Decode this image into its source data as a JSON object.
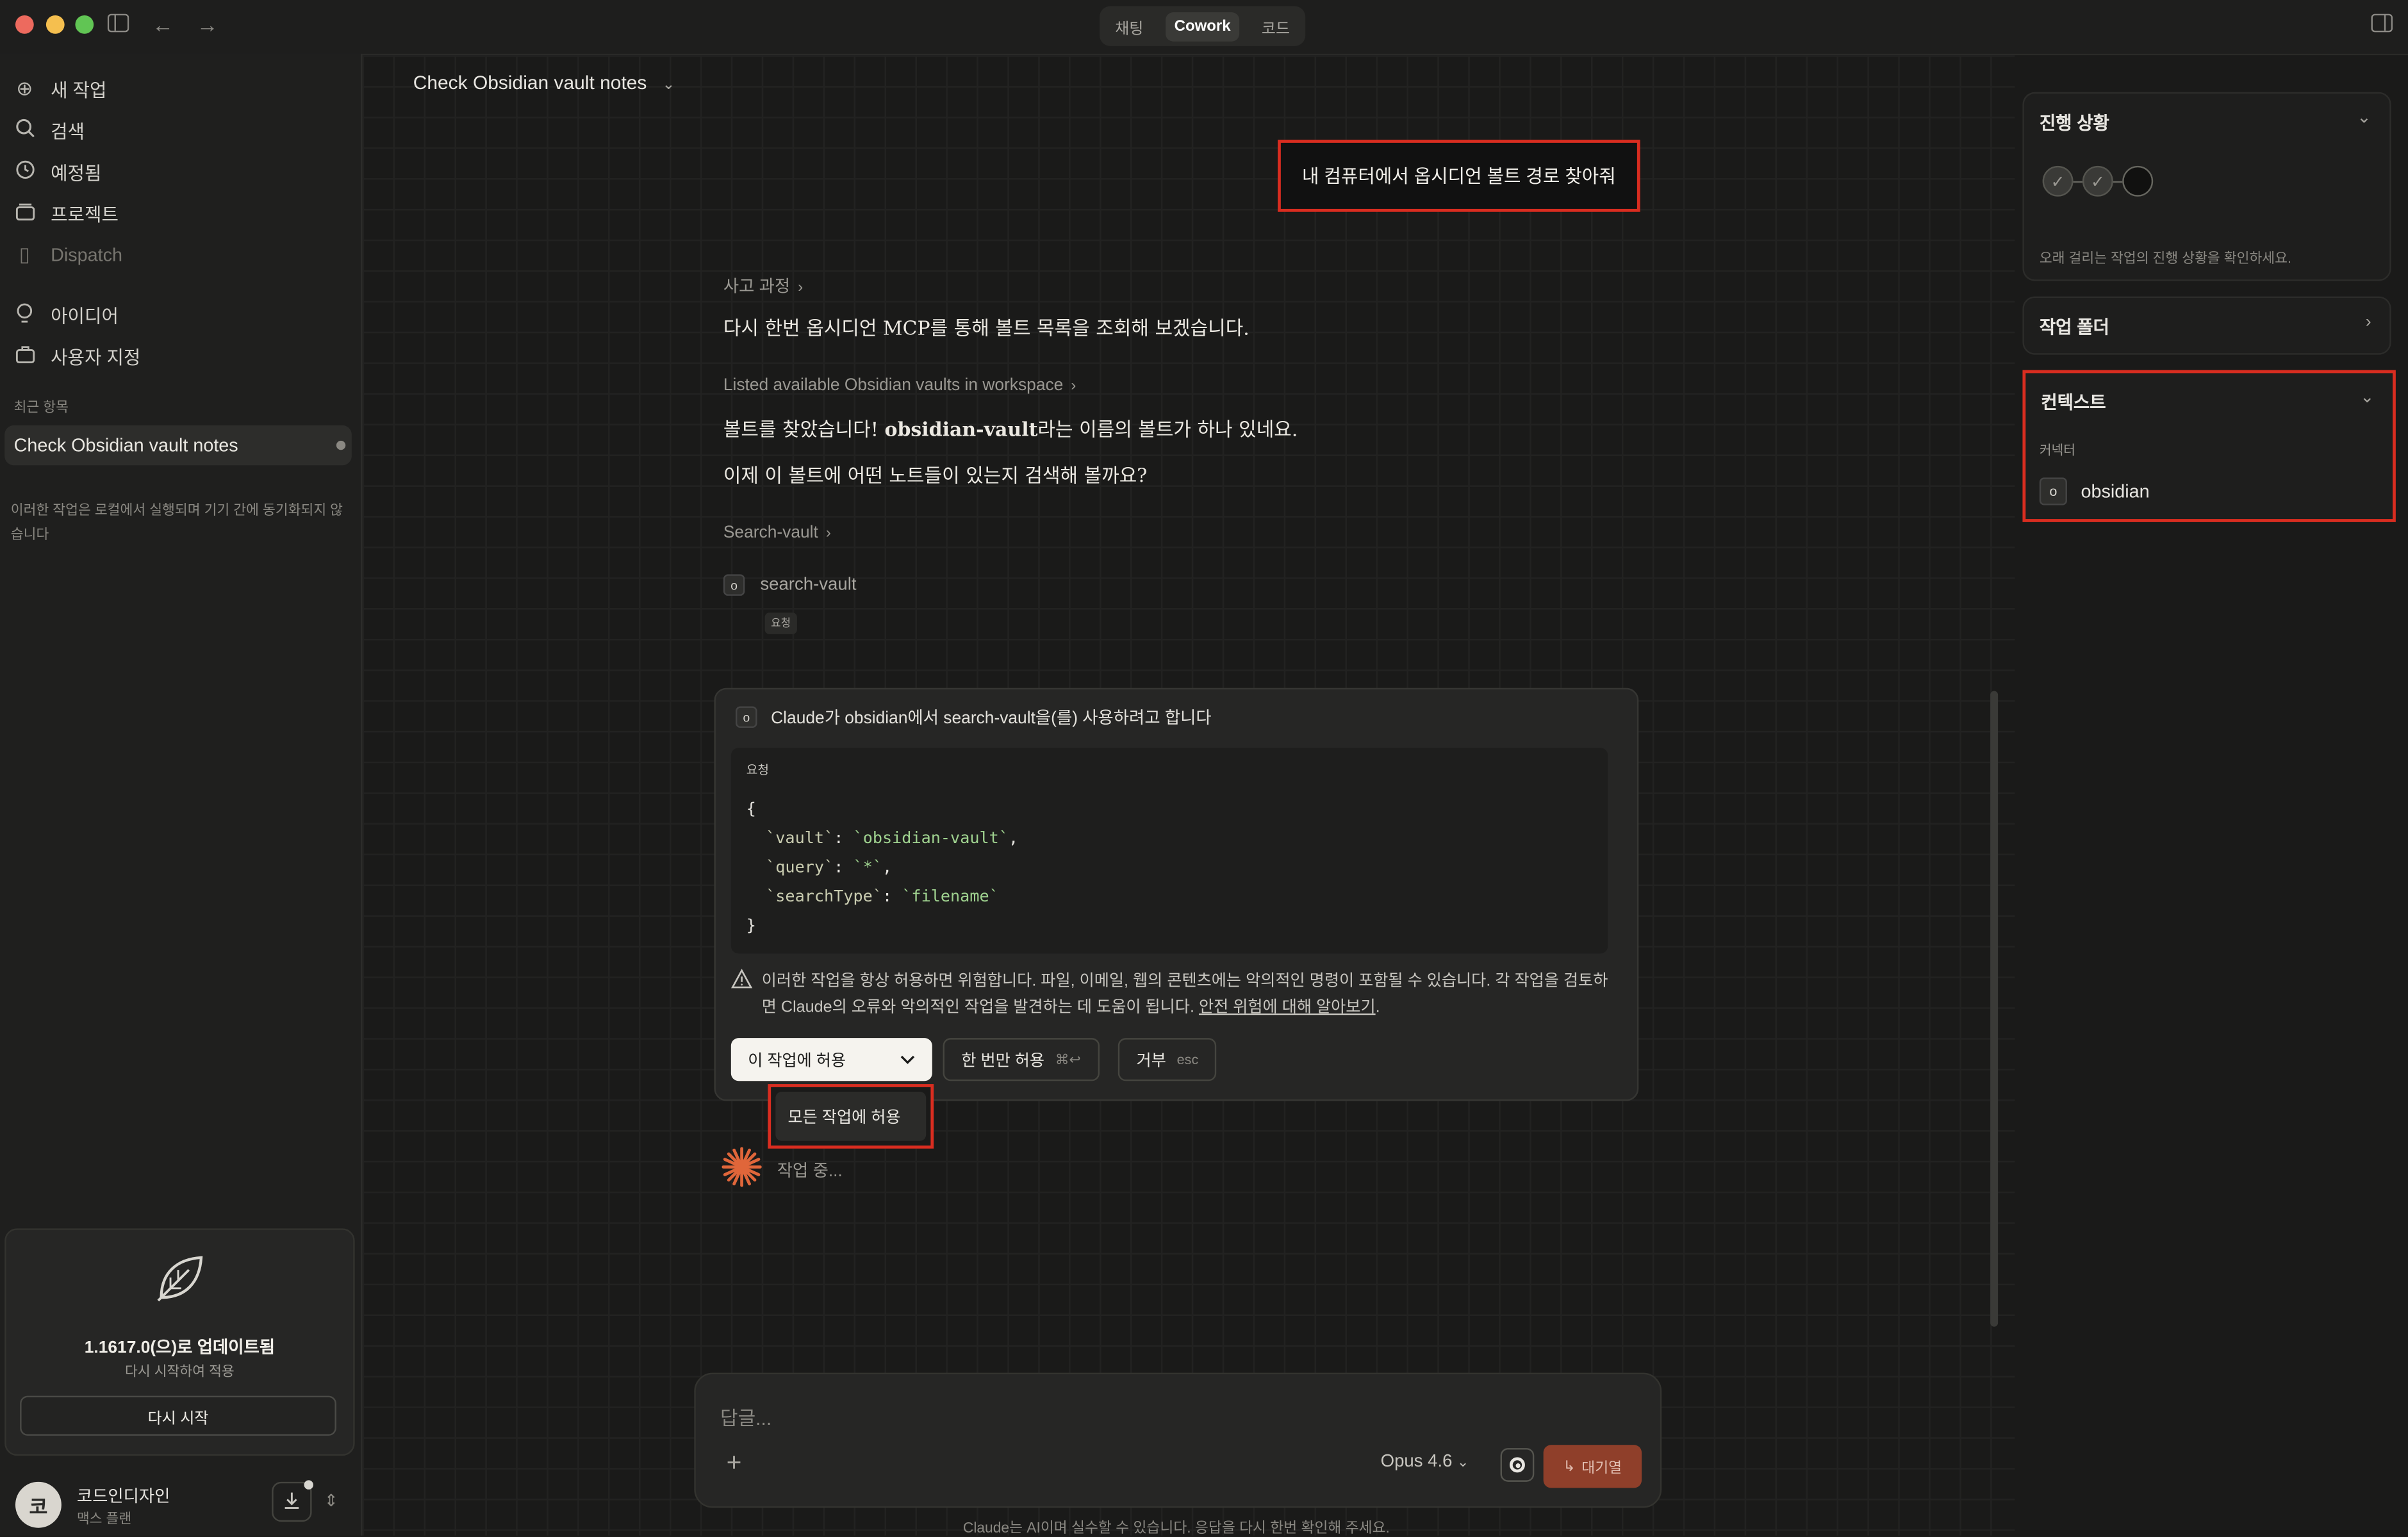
{
  "titlebar": {
    "tabs": [
      {
        "label": "채팅",
        "active": false
      },
      {
        "label": "Cowork",
        "active": true
      },
      {
        "label": "코드",
        "active": false
      }
    ]
  },
  "sidebar": {
    "nav": [
      {
        "label": "새 작업",
        "icon": "plus-icon"
      },
      {
        "label": "검색",
        "icon": "search-icon"
      },
      {
        "label": "예정됨",
        "icon": "clock-icon"
      },
      {
        "label": "프로젝트",
        "icon": "folder-icon"
      },
      {
        "label": "Dispatch",
        "icon": "phone-icon"
      },
      {
        "label": "아이디어",
        "icon": "lightbulb-icon"
      },
      {
        "label": "사용자 지정",
        "icon": "briefcase-icon"
      }
    ],
    "recent_label": "최근 항목",
    "recent_items": [
      "Check Obsidian vault notes"
    ],
    "local_note": "이러한 작업은 로컬에서 실행되며 기기 간에 동기화되지 않습니다",
    "update": {
      "title": "1.1617.0(으)로 업데이트됨",
      "subtitle": "다시 시작하여 적용",
      "button": "다시 시작"
    },
    "user": {
      "avatar": "코",
      "name": "코드인디자인",
      "plan": "맥스 플랜"
    }
  },
  "main": {
    "chat_title": "Check Obsidian vault notes",
    "user_message": "내 컴퓨터에서 옵시디언 볼트 경로 찾아줘",
    "thinking_label": "사고 과정",
    "thinking_text": "다시 한번 옵시디언 MCP를 통해 볼트 목록을 조회해 보겠습니다.",
    "tool_step_label": "Listed available Obsidian vaults in workspace",
    "found_text_pre": "볼트를 찾았습니다! ",
    "found_text_bold": "obsidian-vault",
    "found_text_post": "라는 이름의 볼트가 하나 있네요.",
    "next_text": "이제 이 볼트에 어떤 노트들이 있는지 검색해 볼까요?",
    "search_step_label": "Search-vault",
    "tool_name": "search-vault",
    "tool_tag": "요청",
    "permission": {
      "title": "Claude가 obsidian에서 search-vault을(를) 사용하려고 합니다",
      "code_label": "요청",
      "code": {
        "open": "{",
        "line1_key": "`vault`",
        "line1_val": "`obsidian-vault`",
        "line2_key": "`query`",
        "line2_val": "`*`",
        "line3_key": "`searchType`",
        "line3_val": "`filename`",
        "close": "}"
      },
      "warning": "이러한 작업을 항상 허용하면 위험합니다. 파일, 이메일, 웹의 콘텐츠에는 악의적인 명령이 포함될 수 있습니다. 각 작업을 검토하면 Claude의 오류와 악의적인 작업을 발견하는 데 도움이 됩니다. ",
      "warning_link": "안전 위험에 대해 알아보기",
      "allow_select": "이 작업에 허용",
      "allow_once": "한 번만 허용",
      "allow_once_kbd": "⌘↩",
      "deny": "거부",
      "deny_kbd": "esc",
      "dropdown_option": "모든 작업에 허용"
    },
    "working": "작업 중...",
    "composer": {
      "placeholder": "답글...",
      "model": "Opus 4.6",
      "queue_button": "대기열"
    },
    "disclaimer": "Claude는 AI이며 실수할 수 있습니다. 응답을 다시 한번 확인해 주세요."
  },
  "right_panel": {
    "progress_title": "진행 상황",
    "progress_note": "오래 걸리는 작업의 진행 상황을 확인하세요.",
    "progress_steps": [
      "done",
      "done",
      "pending"
    ],
    "folder_title": "작업 폴더",
    "context_title": "컨텍스트",
    "context_sub": "커넥터",
    "connectors": [
      "obsidian"
    ]
  },
  "colors": {
    "highlight_border": "#d92d20",
    "queue_button_bg": "#8f3f2a",
    "spinner": "#e0663a",
    "code_string": "#9fd28f"
  }
}
